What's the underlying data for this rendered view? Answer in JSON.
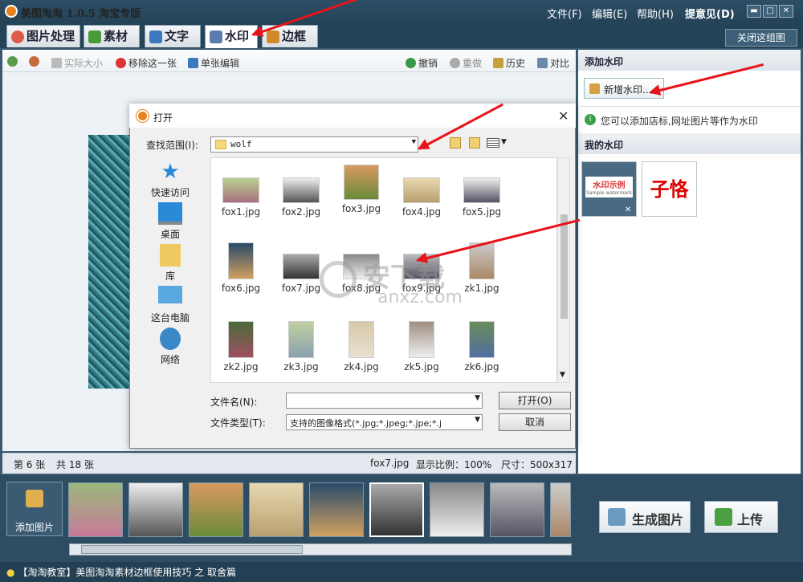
{
  "app": {
    "title": "美图淘淘 1.0.5 淘宝专版"
  },
  "menu": {
    "file": "文件(F)",
    "edit": "编辑(E)",
    "help": "帮助(H)",
    "feedback": "提意见(D)"
  },
  "window_controls": {
    "minimize": "▬",
    "maximize": "□",
    "close": "✕"
  },
  "tabs": [
    {
      "label": "图片处理",
      "icon_color": "#e05a4a"
    },
    {
      "label": "素材",
      "icon_color": "#4a9a3a"
    },
    {
      "label": "文字",
      "icon_color": "#3a78c0"
    },
    {
      "label": "水印",
      "icon_color": "#5a7ab0",
      "active": true
    },
    {
      "label": "边框",
      "icon_color": "#d08a2a"
    }
  ],
  "close_set": "关闭这组图",
  "toolbar": {
    "actual_size": "实际大小",
    "remove": "移除这一张",
    "single_edit": "单张编辑",
    "undo": "撤销",
    "redo": "重做",
    "history": "历史",
    "compare": "对比"
  },
  "status": {
    "index": "第 6 张",
    "total": "共 18 张",
    "filename": "fox7.jpg",
    "zoom": "显示比例：100%",
    "size": "尺寸：500x317"
  },
  "right_panel": {
    "add_header": "添加水印",
    "add_button": "新增水印...",
    "hint": "您可以添加店标,网址图片等作为水印",
    "my_header": "我的水印",
    "wm1_text": "水印示例",
    "wm1_sub": "Sample watermark",
    "wm2_text": "子恪"
  },
  "dialog": {
    "title": "打开",
    "lookin_label": "查找范围(I):",
    "lookin_value": "wolf",
    "sidebar": [
      "快速访问",
      "桌面",
      "库",
      "此电脑",
      "网络"
    ],
    "sidebar_pc": "这台电脑",
    "files": [
      "fox1.jpg",
      "fox2.jpg",
      "fox3.jpg",
      "fox4.jpg",
      "fox5.jpg",
      "fox6.jpg",
      "fox7.jpg",
      "fox8.jpg",
      "fox9.jpg",
      "zk1.jpg",
      "zk2.jpg",
      "zk3.jpg",
      "zk4.jpg",
      "zk5.jpg",
      "zk6.jpg"
    ],
    "filename_label": "文件名(N):",
    "filename_value": "",
    "filetype_label": "文件类型(T):",
    "filetype_value": "支持的图像格式(*.jpg;*.jpeg;*.jpe;*.j",
    "open_button": "打开(O)",
    "cancel_button": "取消"
  },
  "watermark": {
    "text": "安下载",
    "url": "anxz.com"
  },
  "filmstrip": {
    "add": "添加图片"
  },
  "actions": {
    "generate": "生成图片",
    "upload": "上传"
  },
  "tip": "【淘淘教室】美图淘淘素材边框使用技巧 之 取舍篇"
}
